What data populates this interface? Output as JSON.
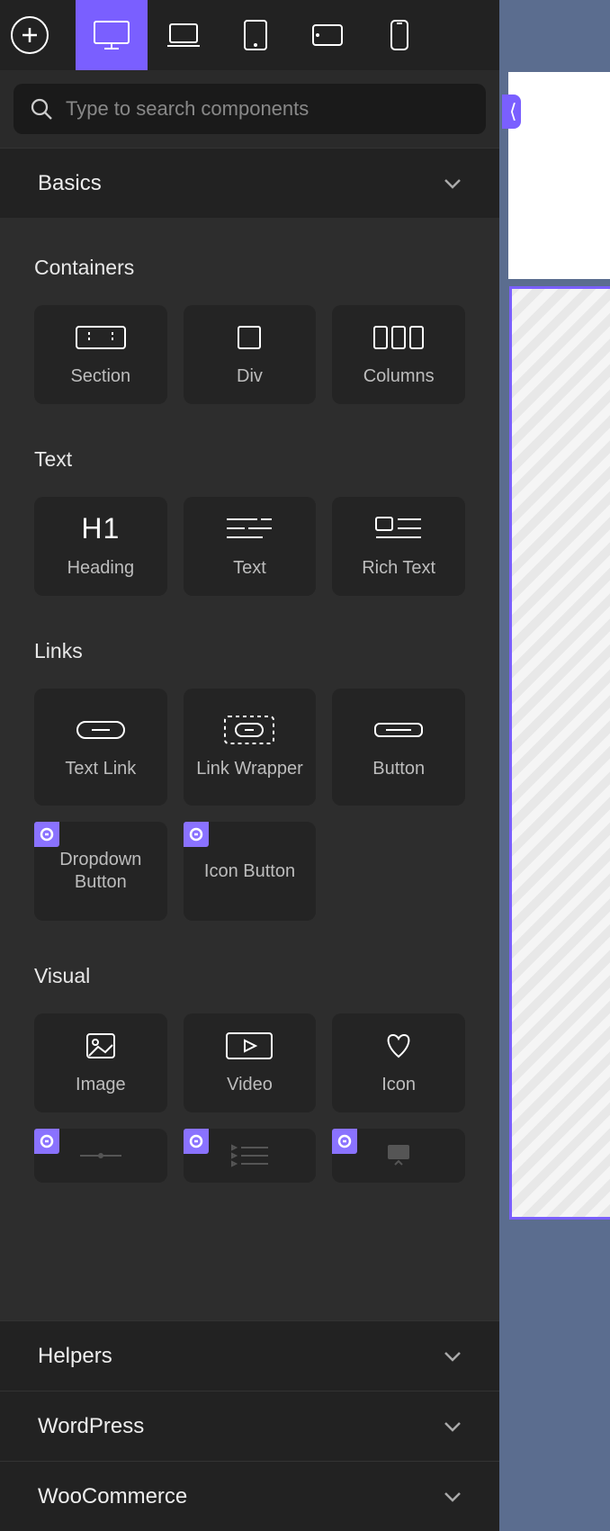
{
  "search": {
    "placeholder": "Type to search components"
  },
  "tag_label": "⟨",
  "sections": {
    "basics": "Basics",
    "helpers": "Helpers",
    "wordpress": "WordPress",
    "woocommerce": "WooCommerce"
  },
  "groups": {
    "containers": {
      "label": "Containers",
      "items": {
        "section": "Section",
        "div": "Div",
        "columns": "Columns"
      }
    },
    "text": {
      "label": "Text",
      "items": {
        "heading": "Heading",
        "text": "Text",
        "richtext": "Rich Text",
        "heading_icon": "H1"
      }
    },
    "links": {
      "label": "Links",
      "items": {
        "textlink": "Text Link",
        "linkwrapper": "Link Wrapper",
        "button": "Button",
        "dropdown": "Dropdown Button",
        "iconbutton": "Icon Button"
      }
    },
    "visual": {
      "label": "Visual",
      "items": {
        "image": "Image",
        "video": "Video",
        "icon": "Icon"
      }
    }
  }
}
